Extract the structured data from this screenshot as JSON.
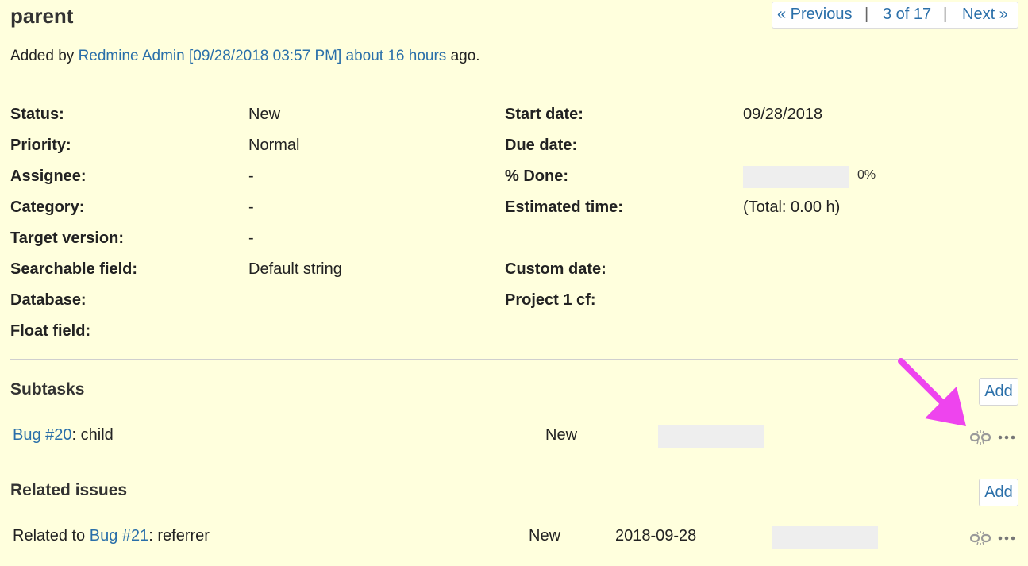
{
  "issue": {
    "title": "parent",
    "added": {
      "prefix": "Added by ",
      "author": "Redmine Admin",
      "date": "[09/28/2018 03:57 PM]",
      "ago": "about 16 hours",
      "suffix": " ago."
    }
  },
  "pager": {
    "previous": "« Previous",
    "sep1": "|",
    "position": "3 of 17",
    "sep2": "|",
    "next": "Next »"
  },
  "attributes": {
    "left": [
      {
        "label": "Status:",
        "value": "New"
      },
      {
        "label": "Priority:",
        "value": "Normal"
      },
      {
        "label": "Assignee:",
        "value": "-"
      },
      {
        "label": "Category:",
        "value": "-"
      },
      {
        "label": "Target version:",
        "value": "-"
      },
      {
        "label": "Searchable field:",
        "value": "Default string"
      },
      {
        "label": "Database:",
        "value": ""
      },
      {
        "label": "Float field:",
        "value": ""
      }
    ],
    "right": [
      {
        "label": "Start date:",
        "value": "09/28/2018"
      },
      {
        "label": "Due date:",
        "value": ""
      },
      {
        "label": "% Done:",
        "value": "0%",
        "progress": 0
      },
      {
        "label": "Estimated time:",
        "value": "(Total: 0.00 h)"
      },
      {
        "label": "Custom date:",
        "value": ""
      },
      {
        "label": "Project 1 cf:",
        "value": ""
      }
    ]
  },
  "subtasks": {
    "title": "Subtasks",
    "add_label": "Add",
    "rows": [
      {
        "link": "Bug #20",
        "subject": ": child",
        "status": "New",
        "progress": 0
      }
    ]
  },
  "related": {
    "title": "Related issues",
    "add_label": "Add",
    "rows": [
      {
        "relation": "Related to ",
        "link": "Bug #21",
        "subject": ": referrer",
        "status": "New",
        "date": "2018-09-28",
        "progress": 0
      }
    ]
  },
  "icons": {
    "unlink": "unlink-icon",
    "actions": "more-actions-icon",
    "annotation": "arrow-annotation"
  },
  "colors": {
    "background": "#ffffdd",
    "link": "#2a6fa9",
    "arrow": "#ee44ee",
    "progress_empty": "#eeeeee"
  }
}
